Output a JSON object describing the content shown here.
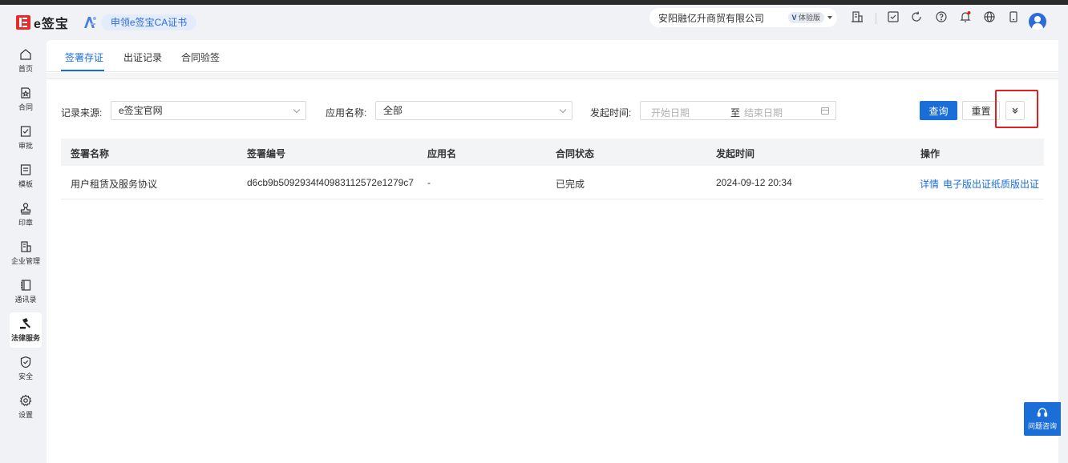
{
  "brand": {
    "name": "e签宝",
    "ca_button": "申领e签宝CA证书"
  },
  "header": {
    "company": "安阳融亿升商贸有限公司",
    "badge_prefix": "V",
    "badge_text": "体验版"
  },
  "sidebar": {
    "items": [
      {
        "label": "首页",
        "icon": "home-icon"
      },
      {
        "label": "合同",
        "icon": "contract-icon"
      },
      {
        "label": "审批",
        "icon": "approval-icon"
      },
      {
        "label": "模板",
        "icon": "template-icon"
      },
      {
        "label": "印章",
        "icon": "seal-icon"
      },
      {
        "label": "企业管理",
        "icon": "enterprise-icon"
      },
      {
        "label": "通讯录",
        "icon": "contacts-icon"
      },
      {
        "label": "法律服务",
        "icon": "legal-icon",
        "active": true
      },
      {
        "label": "安全",
        "icon": "shield-icon"
      },
      {
        "label": "设置",
        "icon": "gear-icon"
      }
    ]
  },
  "tabs": [
    {
      "label": "签署存证",
      "active": true
    },
    {
      "label": "出证记录"
    },
    {
      "label": "合同验签"
    }
  ],
  "filters": {
    "source_label": "记录来源:",
    "source_value": "e签宝官网",
    "app_label": "应用名称:",
    "app_value": "全部",
    "time_label": "发起时间:",
    "start_placeholder": "开始日期",
    "separator": "至",
    "end_placeholder": "结束日期",
    "query": "查询",
    "reset": "重置"
  },
  "table": {
    "columns": [
      "签署名称",
      "签署编号",
      "应用名",
      "合同状态",
      "发起时间",
      "操作"
    ],
    "rows": [
      {
        "name": "用户租赁及服务协议",
        "id": "d6cb9b5092934f40983112572e1279c7",
        "app": "-",
        "status": "已完成",
        "time": "2024-09-12 20:34",
        "actions": [
          "详情",
          "电子版出证",
          "纸质版出证"
        ]
      }
    ]
  },
  "help": {
    "label": "问题咨询"
  },
  "colors": {
    "primary": "#1a6ed8",
    "logo": "#e52c2c",
    "highlight": "#e02020"
  }
}
